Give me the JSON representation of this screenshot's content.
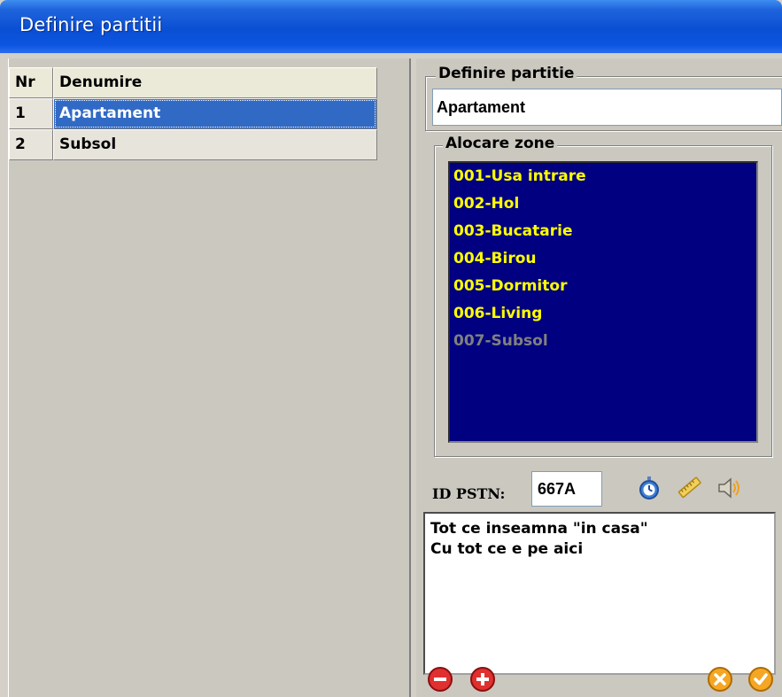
{
  "window": {
    "title": "Definire partitii"
  },
  "grid": {
    "headers": {
      "nr": "Nr",
      "denumire": "Denumire"
    },
    "rows": [
      {
        "nr": "1",
        "denumire": "Apartament",
        "selected": true
      },
      {
        "nr": "2",
        "denumire": "Subsol",
        "selected": false
      }
    ]
  },
  "definition": {
    "legend": "Definire partitie",
    "name_value": "Apartament"
  },
  "zones": {
    "legend": "Alocare zone",
    "items": [
      {
        "label": "001-Usa intrare",
        "active": true
      },
      {
        "label": "002-Hol",
        "active": true
      },
      {
        "label": "003-Bucatarie",
        "active": true
      },
      {
        "label": "004-Birou",
        "active": true
      },
      {
        "label": "005-Dormitor",
        "active": true
      },
      {
        "label": "006-Living",
        "active": true
      },
      {
        "label": "007-Subsol",
        "active": false
      }
    ]
  },
  "pstn": {
    "label": "ID PSTN:",
    "value": "667A"
  },
  "notes": {
    "text": "Tot ce inseamna \"in casa\"\nCu tot ce e pe aici"
  },
  "icons": {
    "timer": "stopwatch-icon",
    "ruler": "ruler-icon",
    "sound": "speaker-icon",
    "remove": "minus-circle-icon",
    "add": "plus-circle-icon",
    "cancel": "x-circle-icon",
    "ok": "check-circle-icon"
  },
  "colors": {
    "zone_bg": "#000080",
    "zone_active": "#ffff00",
    "zone_inactive": "#808080",
    "selection": "#316ac5",
    "title_bar": "#0a4fd4"
  }
}
